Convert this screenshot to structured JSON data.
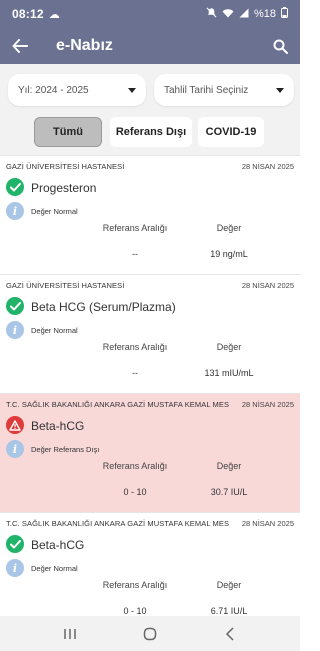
{
  "status_bar": {
    "time": "08:12",
    "battery_text": "%18"
  },
  "app_bar": {
    "title": "e-Nabız"
  },
  "filters": {
    "year_select": "Yıl: 2024 - 2025",
    "date_select": "Tahlil Tarihi Seçiniz",
    "tabs": [
      {
        "label": "Tümü",
        "selected": true
      },
      {
        "label": "Referans Dışı",
        "selected": false
      },
      {
        "label": "COVID-19",
        "selected": false
      }
    ]
  },
  "results": [
    {
      "hospital": "GAZİ ÜNİVERSİTESİ HASTANESİ",
      "date": "28 NİSAN 2025",
      "test_name": "Progesteron",
      "status": "Değer Normal",
      "status_type": "normal",
      "ref_header": "Referans Aralığı",
      "value_header": "Değer",
      "ref_range": "--",
      "value": "19 ng/mL"
    },
    {
      "hospital": "GAZİ ÜNİVERSİTESİ HASTANESİ",
      "date": "28 NİSAN 2025",
      "test_name": "Beta HCG (Serum/Plazma)",
      "status": "Değer Normal",
      "status_type": "normal",
      "ref_header": "Referans Aralığı",
      "value_header": "Değer",
      "ref_range": "--",
      "value": "131 mIU/mL"
    },
    {
      "hospital": "T.C. SAĞLIK BAKANLIĞI ANKARA GAZİ MUSTAFA KEMAL MES",
      "date": "28 NİSAN 2025",
      "test_name": "Beta-hCG",
      "status": "Değer Referans Dışı",
      "status_type": "out_of_range",
      "ref_header": "Referans Aralığı",
      "value_header": "Değer",
      "ref_range": "0 - 10",
      "value": "30.7 IU/L"
    },
    {
      "hospital": "T.C. SAĞLIK BAKANLIĞI ANKARA GAZİ MUSTAFA KEMAL MES",
      "date": "28 NİSAN 2025",
      "test_name": "Beta-hCG",
      "status": "Değer Normal",
      "status_type": "normal",
      "ref_header": "Referans Aralığı",
      "value_header": "Değer",
      "ref_range": "0 - 10",
      "value": "6.71 IU/L"
    }
  ],
  "colors": {
    "app_bar": "#6b7191",
    "normal_icon": "#22b36b",
    "alert_icon": "#e03b3b",
    "alert_card_bg": "#f9d8d8",
    "info_icon": "#a9c6e6"
  }
}
